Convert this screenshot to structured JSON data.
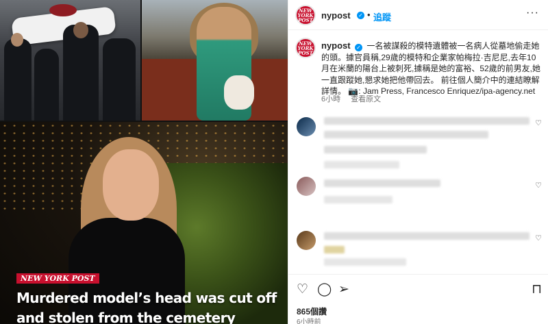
{
  "media": {
    "badge": "NEW YORK POST",
    "headline_line1": "Murdered model’s head was cut off",
    "headline_line2": "and stolen from the cemetery"
  },
  "post": {
    "username": "nypost",
    "follow_label": "追蹤",
    "more_label": "···",
    "avatar_text": "NEW YORK POST",
    "caption_user": "nypost",
    "caption_text": "一名被謀殺的模特遺體被一名病人從墓地偷走她的頭。據官員稱,29歲的模特和企業家帕梅拉·吉尼尼,去年10月在米蘭的陽台上被刺死,據稱是她的富裕、52歲的前男友,她一直跟蹤她,懇求她把他帶回去。 前往個人簡介中的連結瞭解詳情。 📷: Jam Press, Francesco Enriquez/ipa-agency.net",
    "caption_time": "6小時",
    "see_original": "查看原文"
  },
  "actions": {
    "likes": "865個讚",
    "time": "6小時前"
  },
  "colors": {
    "accent": "#0095f6",
    "brand": "#c8102e"
  }
}
